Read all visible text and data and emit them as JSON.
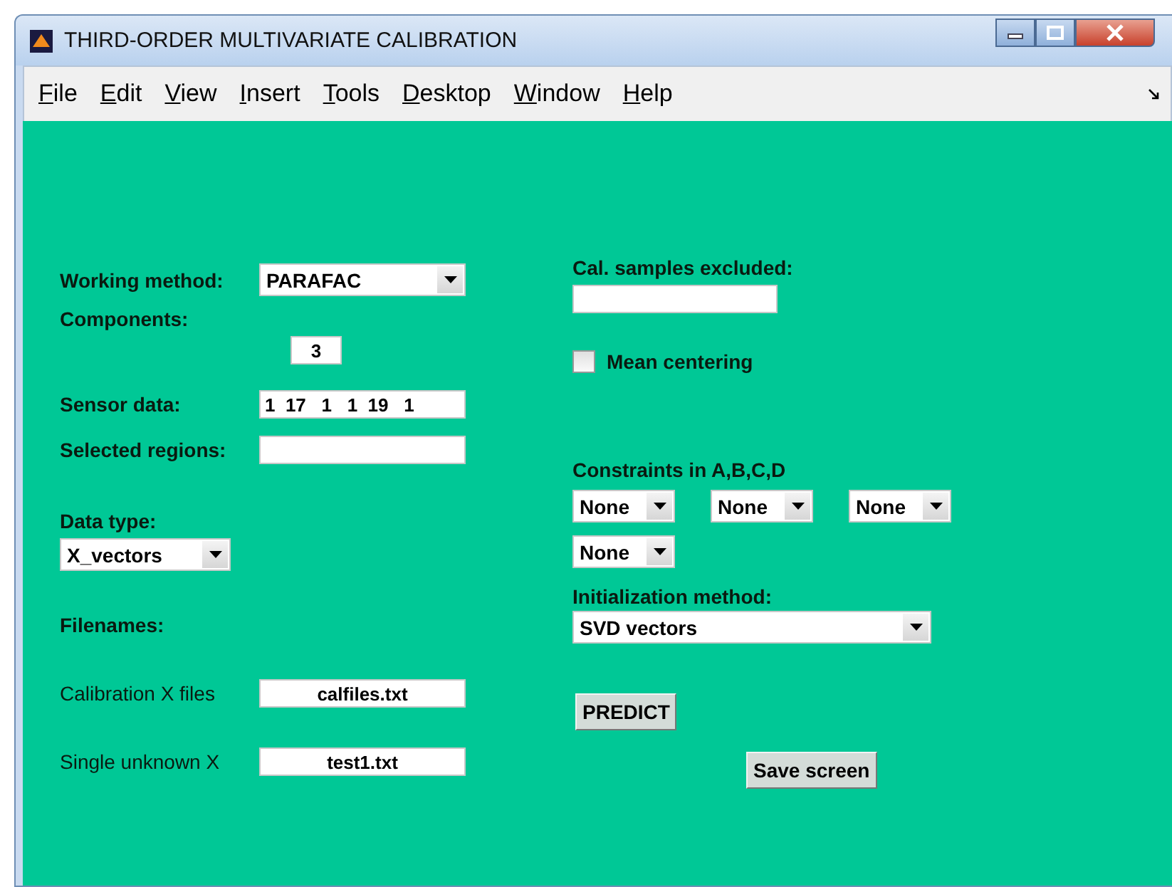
{
  "window": {
    "title": "THIRD-ORDER MULTIVARIATE CALIBRATION"
  },
  "menu": [
    "File",
    "Edit",
    "View",
    "Insert",
    "Tools",
    "Desktop",
    "Window",
    "Help"
  ],
  "working_method": {
    "label": "Working method:",
    "value": "PARAFAC"
  },
  "components": {
    "label": "Components:",
    "value": "3"
  },
  "sensor_data": {
    "label": "Sensor data:",
    "value": "1  17   1   1  19   1"
  },
  "selected_regions": {
    "label": "Selected regions:"
  },
  "data_type": {
    "label": "Data type:",
    "value": "X_vectors"
  },
  "filenames": {
    "label": "Filenames:",
    "fields": [
      {
        "label": "Calibration X files",
        "value": "calfiles.txt"
      },
      {
        "label": "Single unknown X",
        "value": "test1.txt"
      }
    ]
  },
  "cal_samples_excluded": {
    "label": "Cal. samples excluded:"
  },
  "mean_centering": {
    "label": "Mean centering",
    "checked": false
  },
  "constraints": {
    "label": "Constraints in A,B,C,D",
    "values": [
      "None",
      "None",
      "None",
      "None"
    ]
  },
  "initialization": {
    "label": "Initialization method:",
    "value": "SVD vectors"
  },
  "buttons": [
    "PREDICT",
    "Save screen"
  ]
}
